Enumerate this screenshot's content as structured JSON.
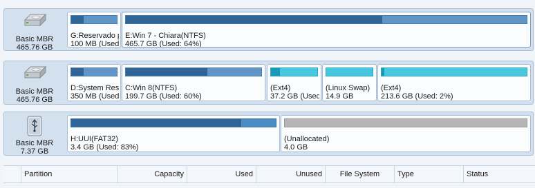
{
  "disks": [
    {
      "type": "Basic MBR",
      "size": "465.76 GB",
      "icon": "hdd-icon",
      "partitions": [
        {
          "name": "G:Reservado p",
          "detail": "100 MB (Used:",
          "fs": "ntfs",
          "used_fraction": 0.27
        },
        {
          "name": "E:Win 7 - Chiara(NTFS)",
          "detail": "465.7 GB (Used: 64%)",
          "fs": "ntfs",
          "used_fraction": 0.64
        }
      ]
    },
    {
      "type": "Basic MBR",
      "size": "465.76 GB",
      "icon": "hdd-icon",
      "partitions": [
        {
          "name": "D:System Rese",
          "detail": "350 MB (Used:",
          "fs": "ntfs",
          "used_fraction": 0.27
        },
        {
          "name": "C:Win 8(NTFS)",
          "detail": "199.7 GB (Used: 60%)",
          "fs": "ntfs",
          "used_fraction": 0.6
        },
        {
          "name": "(Ext4)",
          "detail": "37.2 GB (Used",
          "fs": "ext",
          "used_fraction": 0.2
        },
        {
          "name": "(Linux Swap)",
          "detail": "14.9 GB",
          "fs": "swap",
          "used_fraction": 0
        },
        {
          "name": "(Ext4)",
          "detail": "213.6 GB (Used: 2%)",
          "fs": "ext",
          "used_fraction": 0.02
        }
      ]
    },
    {
      "type": "Basic MBR",
      "size": "7.37 GB",
      "icon": "usb-drive-icon",
      "partitions": [
        {
          "name": "H:UUI(FAT32)",
          "detail": "3.4 GB (Used: 83%)",
          "fs": "fat",
          "used_fraction": 0.83
        },
        {
          "name": "(Unallocated)",
          "detail": "4.0 GB",
          "fs": "unalloc",
          "used_fraction": 0
        }
      ]
    }
  ],
  "columns": [
    "Partition",
    "Capacity",
    "Used",
    "Unused",
    "File System",
    "Type",
    "Status"
  ],
  "colors": {
    "ntfs_used": "#2f6497",
    "ntfs_free": "#5f95c7",
    "ext": "#49c8e0",
    "unallocated": "#b5b5b5",
    "panel": "#d3e1ef"
  }
}
